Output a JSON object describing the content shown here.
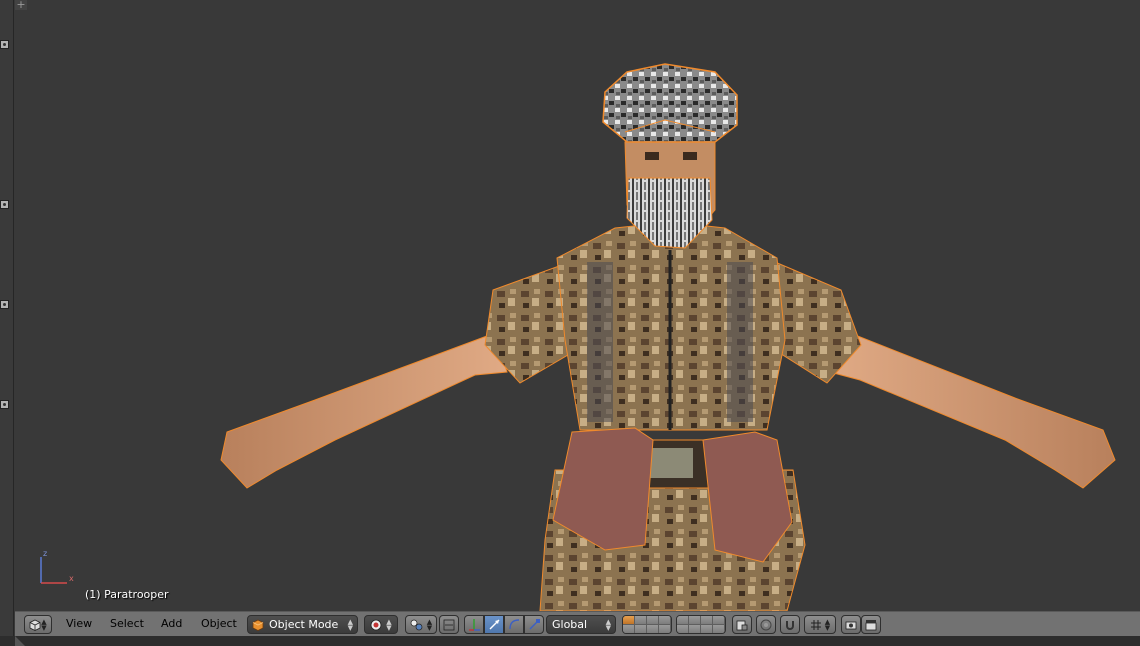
{
  "viewport": {
    "object_label": "(1) Paratrooper",
    "axis_labels": {
      "x": "x",
      "z": "z"
    }
  },
  "header": {
    "menus": [
      "View",
      "Select",
      "Add",
      "Object"
    ],
    "mode_dropdown": {
      "value": "Object Mode"
    },
    "orientation_dropdown": {
      "value": "Global"
    }
  },
  "colors": {
    "viewport_bg": "#393939",
    "header_bg": "#727272",
    "selection_outline": "#f08a2c",
    "active_tool": "#5680bb"
  },
  "icons": {
    "editor_type": "3d-view-cube-icon",
    "viewport_shade": "solid-shading-icon",
    "pivot": "pivot-point-icon",
    "manipulator": "manipulator-axes-icon",
    "translate": "translate-arrow-icon",
    "rotate": "rotate-arc-icon",
    "scale": "scale-icon",
    "snap": "snap-magnet-icon",
    "render": "render-camera-icon",
    "animation": "clapper-icon"
  }
}
